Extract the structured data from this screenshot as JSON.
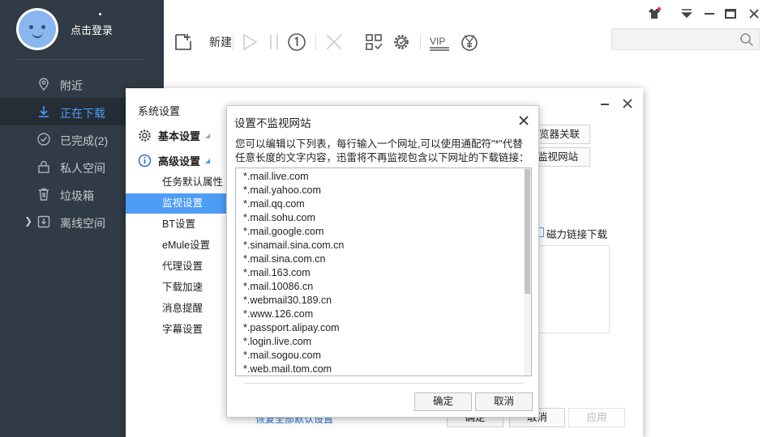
{
  "sidebar": {
    "login_label": "点击登录",
    "items": [
      {
        "label": "附近",
        "icon": "location-pin-icon"
      },
      {
        "label": "正在下载",
        "icon": "download-arrow-icon",
        "active": true
      },
      {
        "label": "已完成(2)",
        "icon": "check-circle-icon"
      },
      {
        "label": "私人空间",
        "icon": "lock-icon"
      },
      {
        "label": "垃圾箱",
        "icon": "trash-icon"
      },
      {
        "label": "离线空间",
        "icon": "cloud-download-icon"
      }
    ]
  },
  "toolbar": {
    "new_label": "新建",
    "vip_label": "VIP",
    "search": {
      "placeholder": "",
      "icon": "search-icon"
    }
  },
  "settings": {
    "title": "系统设置",
    "groups": [
      {
        "label": "基本设置",
        "icon": "gear-icon"
      },
      {
        "label": "高级设置",
        "icon": "info-circle-icon"
      }
    ],
    "advanced_items": [
      {
        "label": "任务默认属性"
      },
      {
        "label": "监视设置",
        "active": true
      },
      {
        "label": "BT设置"
      },
      {
        "label": "eMule设置"
      },
      {
        "label": "代理设置"
      },
      {
        "label": "下载加速"
      },
      {
        "label": "消息提醒"
      },
      {
        "label": "字幕设置"
      }
    ],
    "peek": {
      "browser_assoc_btn": "览器关联",
      "monitor_sites_btn": "监视网站",
      "magnet_label": "磁力链接下载",
      "restore_link": "恢复全部默认设置"
    },
    "footer": {
      "ok": "确定",
      "cancel": "取消",
      "apply": "应用"
    }
  },
  "dialog": {
    "title": "设置不监视网站",
    "description": "您可以编辑以下列表，每行输入一个网址,可以使用通配符\"*\"代替任意长度的文字内容，迅雷将不再监视包含以下网址的下载链接：",
    "sites": [
      "*.mail.live.com",
      "*.mail.yahoo.com",
      "*.mail.qq.com",
      "*.mail.sohu.com",
      "*.mail.google.com",
      "*.sinamail.sina.com.cn",
      "*.mail.sina.com.cn",
      "*.mail.163.com",
      "*.mail.10086.cn",
      "*.webmail30.189.cn",
      "*.www.126.com",
      "*.passport.alipay.com",
      "*.login.live.com",
      "*.mail.sogou.com",
      "*.web.mail.tom.com"
    ],
    "ok_label": "确定",
    "cancel_label": "取消"
  },
  "colors": {
    "sidebar_bg": "#313b45",
    "accent": "#4d9cf5",
    "active_row": "#252d36"
  }
}
